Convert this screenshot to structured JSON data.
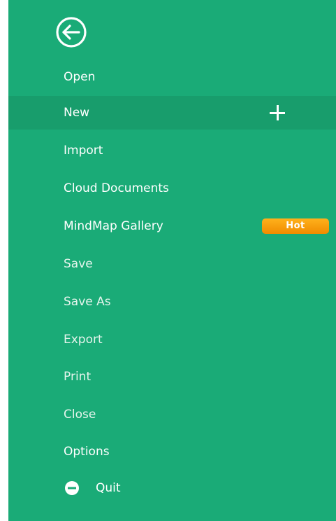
{
  "menu": {
    "back_icon": "back-arrow-circle-icon",
    "items": [
      {
        "label": "Open"
      },
      {
        "label": "New",
        "icon": "plus-icon"
      },
      {
        "label": "Import"
      },
      {
        "label": "Cloud Documents"
      },
      {
        "label": "MindMap Gallery",
        "badge": "Hot"
      },
      {
        "label": "Save"
      },
      {
        "label": "Save As"
      },
      {
        "label": "Export"
      },
      {
        "label": "Print"
      },
      {
        "label": "Close"
      },
      {
        "label": "Options"
      },
      {
        "label": "Quit",
        "icon": "minus-circle-icon"
      }
    ],
    "selected": "New"
  },
  "colors": {
    "panel_bg": "#1aab77",
    "selected_bg": "#189d6c",
    "badge_bg": "#f59a0c",
    "text": "#ffffff"
  }
}
